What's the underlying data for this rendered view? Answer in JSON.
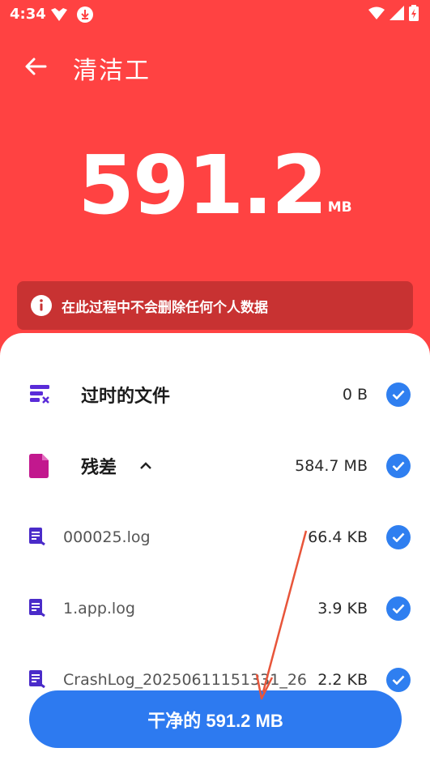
{
  "status_bar": {
    "time": "4:34"
  },
  "header": {
    "title": "清洁工"
  },
  "summary": {
    "value": "591.2",
    "unit": "MB"
  },
  "info_banner": {
    "text": "在此过程中不会删除任何个人数据"
  },
  "categories": [
    {
      "title": "过时的文件",
      "size": "0 B",
      "checked": true
    },
    {
      "title": "残差",
      "size": "584.7 MB",
      "checked": true,
      "expanded": true
    }
  ],
  "files": [
    {
      "name": "000025.log",
      "size": "66.4 KB",
      "checked": true
    },
    {
      "name": "1.app.log",
      "size": "3.9 KB",
      "checked": true
    },
    {
      "name": "CrashLog_20250611151331_26",
      "size": "2.2 KB",
      "checked": true
    }
  ],
  "action": {
    "clean_label": "干净的 591.2 MB"
  },
  "colors": {
    "header_bg": "#ff4242",
    "banner_bg": "#c83232",
    "accent": "#2d7af0",
    "annotation": "#e8553a"
  }
}
